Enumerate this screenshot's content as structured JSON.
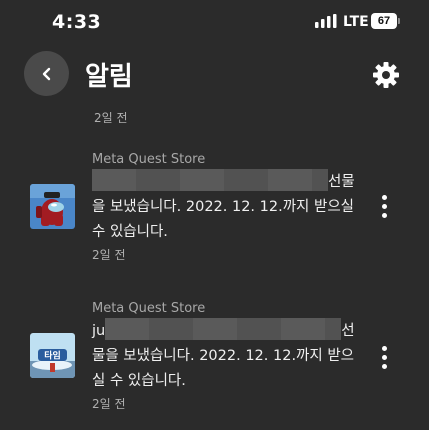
{
  "status_bar": {
    "time": "4:33",
    "network": "LTE",
    "battery": "67",
    "icons": [
      "signal-icon",
      "battery-icon"
    ]
  },
  "header": {
    "title": "알림",
    "icons": [
      "back-arrow-icon",
      "settings-gear-icon"
    ]
  },
  "top_time": "2일 전",
  "notifications": [
    {
      "source": "Meta Quest Store",
      "prefix": "",
      "line1_end": "선물",
      "rest": "을 보냈습니다. 2022. 12. 12.까지 받으실 수 있습니다.",
      "time": "2일 전",
      "thumb_icon": "among-us-app-icon"
    },
    {
      "source": "Meta Quest Store",
      "prefix": "ju",
      "line1_end": "선",
      "rest": "물을 보냈습니다. 2022. 12. 12.까지 받으실 수 있습니다.",
      "time": "2일 전",
      "thumb_icon": "game-app-icon"
    }
  ],
  "colors": {
    "background": "#2b2b2b",
    "text": "#f2f2f2",
    "muted": "#b0b0b0",
    "back_button": "#4a4a4a",
    "redaction": "#5a5a5a"
  }
}
